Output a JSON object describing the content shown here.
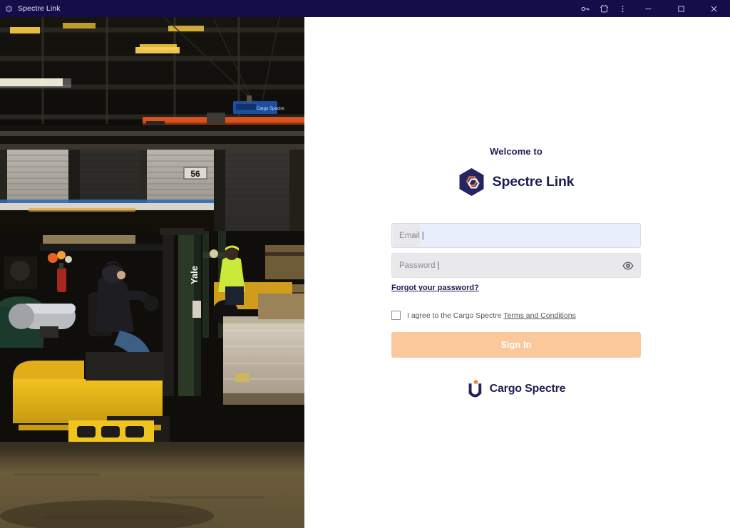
{
  "window": {
    "title": "Spectre Link",
    "app_icon": "spectre-link-app-icon",
    "controls": [
      {
        "name": "key-icon",
        "glyph": "key"
      },
      {
        "name": "cast-device-icon",
        "glyph": "cast"
      },
      {
        "name": "more-options-icon",
        "glyph": "kebab"
      },
      {
        "name": "minimize-icon",
        "glyph": "minimize"
      },
      {
        "name": "maximize-icon",
        "glyph": "maximize"
      },
      {
        "name": "close-icon",
        "glyph": "close"
      }
    ]
  },
  "hero": {
    "alt": "Warehouse interior with a yellow Yale forklift, worker in hi-vis jacket, wrapped pallets and loading dock door number 56"
  },
  "login": {
    "welcome": "Welcome to",
    "product_name": "Spectre Link",
    "email": {
      "placeholder": "Email",
      "value": ""
    },
    "password": {
      "placeholder": "Password",
      "value": ""
    },
    "show_password_icon": "eye-icon",
    "forgot_password": "Forgot your password?",
    "agree_prefix": "I agree to the Cargo Spectre",
    "terms_link": "Terms and Conditions",
    "agree_checked": false,
    "submit_label": "Sign In",
    "footer_brand": "Cargo Spectre"
  },
  "colors": {
    "titlebar": "#130e4a",
    "brand_navy": "#1d1d52",
    "brand_orange": "#e2793d",
    "button_peach": "#fbc89b",
    "email_field_bg": "#e8eefb",
    "password_field_bg": "#e9e9ec",
    "panel_bg": "#ffffff"
  }
}
